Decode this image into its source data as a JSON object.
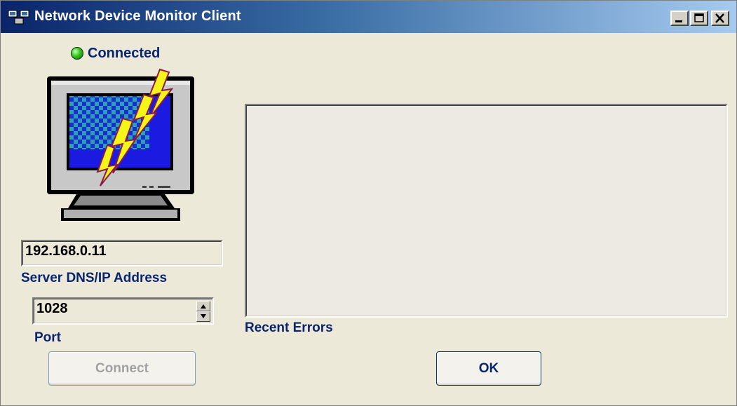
{
  "window": {
    "title": "Network Device Monitor Client",
    "controls": {
      "minimize_icon": "minimize-icon",
      "maximize_icon": "maximize-icon",
      "close_icon": "close-icon"
    }
  },
  "status": {
    "label": "Connected",
    "indicator_color": "#31c41f"
  },
  "server": {
    "address_value": "192.168.0.11",
    "address_label": "Server DNS/IP Address",
    "port_value": "1028",
    "port_label": "Port"
  },
  "buttons": {
    "connect_label": "Connect",
    "connect_enabled": false,
    "ok_label": "OK"
  },
  "errors": {
    "label": "Recent Errors",
    "items": []
  },
  "colors": {
    "label_text": "#0a2470",
    "title_gradient_start": "#0a246a",
    "title_gradient_end": "#a6caf0",
    "window_bg": "#ece9d8"
  }
}
